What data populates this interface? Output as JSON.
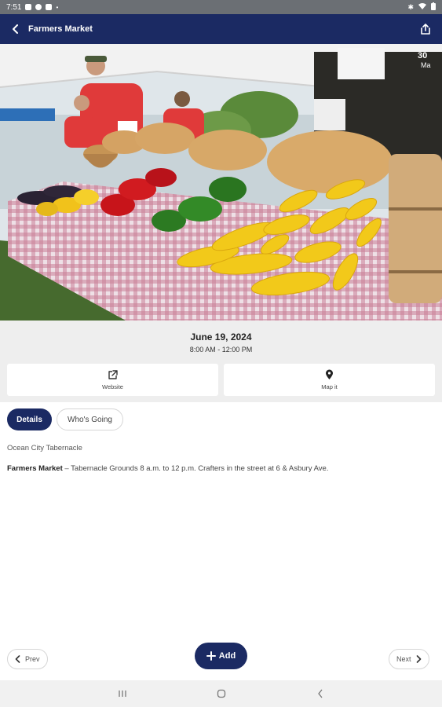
{
  "status_bar": {
    "time": "7:51"
  },
  "app_bar": {
    "title": "Farmers Market"
  },
  "hero": {
    "image_overlay_text_1": "30",
    "image_overlay_text_2": "Ma"
  },
  "event": {
    "date": "June 19, 2024",
    "time_range": "8:00 AM - 12:00 PM"
  },
  "actions": {
    "website_label": "Website",
    "map_label": "Map it"
  },
  "tabs": {
    "details": "Details",
    "whos_going": "Who's Going"
  },
  "details": {
    "venue": "Ocean City Tabernacle",
    "title": "Farmers Market",
    "separator": " – ",
    "body": "Tabernacle Grounds 8 a.m. to 12 p.m. Crafters in the street at 6 & Asbury Ave."
  },
  "footer": {
    "prev_label": "Prev",
    "add_label": "Add",
    "next_label": "Next"
  },
  "colors": {
    "primary": "#1b2a63",
    "panel": "#eeeeee"
  },
  "icons": {
    "back": "arrow-left-icon",
    "share": "share-icon",
    "website": "external-link-icon",
    "map": "map-pin-icon",
    "add": "plus-icon",
    "prev": "chevron-left-icon",
    "next": "chevron-right-icon"
  }
}
